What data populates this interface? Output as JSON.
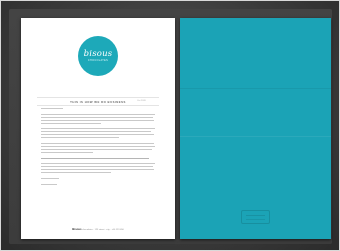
{
  "logo": {
    "script_text": "bisous",
    "sub_text": "CHOCOLATES"
  },
  "letter": {
    "title": "THIS IS HOW WE DO BUSINESS",
    "date": "Oct 2020",
    "footer_brand": "Bisous",
    "footer_contact": "chocolates · 123 street · city · +00 123 456"
  },
  "colors": {
    "brand_teal": "#1ba3b6",
    "logo_teal": "#1da9b9",
    "paper": "#ffffff",
    "background": "#3e3e3e"
  }
}
